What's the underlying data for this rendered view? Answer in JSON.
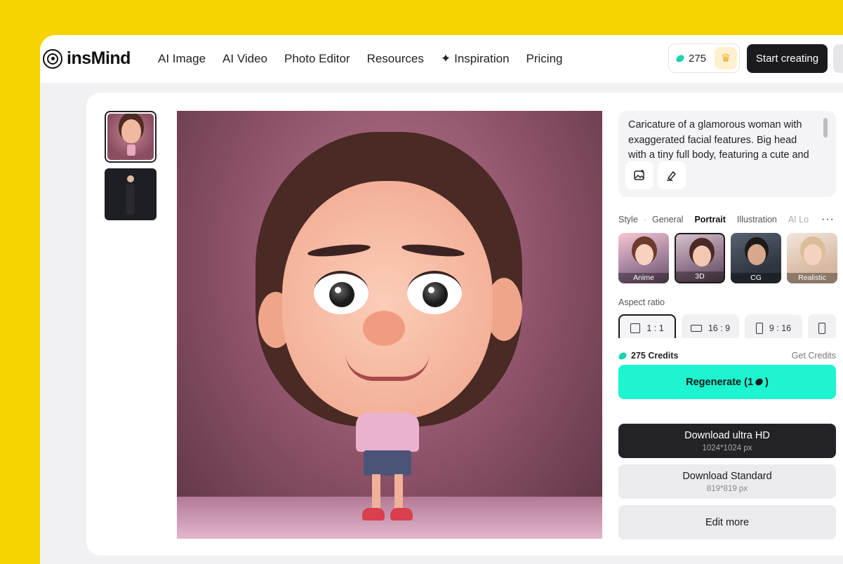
{
  "brand": {
    "name": "insMind"
  },
  "nav": {
    "items": [
      {
        "label": "AI Image"
      },
      {
        "label": "AI Video"
      },
      {
        "label": "Photo Editor"
      },
      {
        "label": "Resources"
      },
      {
        "label": "Inspiration",
        "icon": "sparkle-icon"
      },
      {
        "label": "Pricing"
      }
    ]
  },
  "account": {
    "credits": "275",
    "crown_icon": "crown-icon"
  },
  "header": {
    "start_label": "Start creating"
  },
  "thumbnails": [
    {
      "name": "cartoon-girl-3d",
      "selected": true
    },
    {
      "name": "dark-figure",
      "selected": false
    }
  ],
  "prompt": {
    "text": "Caricature of a glamorous woman with exaggerated facial features. Big head with a tiny full body, featuring a cute and",
    "tools": [
      "image-add-icon",
      "brush-icon"
    ]
  },
  "style": {
    "label": "Style",
    "tabs": [
      {
        "label": "General",
        "active": false
      },
      {
        "label": "Portrait",
        "active": true
      },
      {
        "label": "Illustration",
        "active": false
      },
      {
        "label": "AI Lo",
        "active": false
      }
    ],
    "cards": [
      {
        "label": "Anime",
        "selected": false
      },
      {
        "label": "3D",
        "selected": true
      },
      {
        "label": "CG",
        "selected": false
      },
      {
        "label": "Realistic",
        "selected": false
      }
    ]
  },
  "aspect": {
    "label": "Aspect ratio",
    "options": [
      {
        "label": "1 : 1",
        "selected": true
      },
      {
        "label": "16 : 9",
        "selected": false
      },
      {
        "label": "9 : 16",
        "selected": false
      }
    ]
  },
  "credits_row": {
    "credits": "275 Credits",
    "get": "Get Credits"
  },
  "regenerate": {
    "label": "Regenerate (1",
    "suffix": ")"
  },
  "download_hd": {
    "label": "Download ultra HD",
    "size": "1024*1024 px"
  },
  "download_std": {
    "label": "Download Standard",
    "size": "819*819 px"
  },
  "edit": {
    "label": "Edit more"
  },
  "colors": {
    "background": "#f7d300",
    "accent": "#1cf5cf",
    "dark": "#1b1b1f"
  }
}
